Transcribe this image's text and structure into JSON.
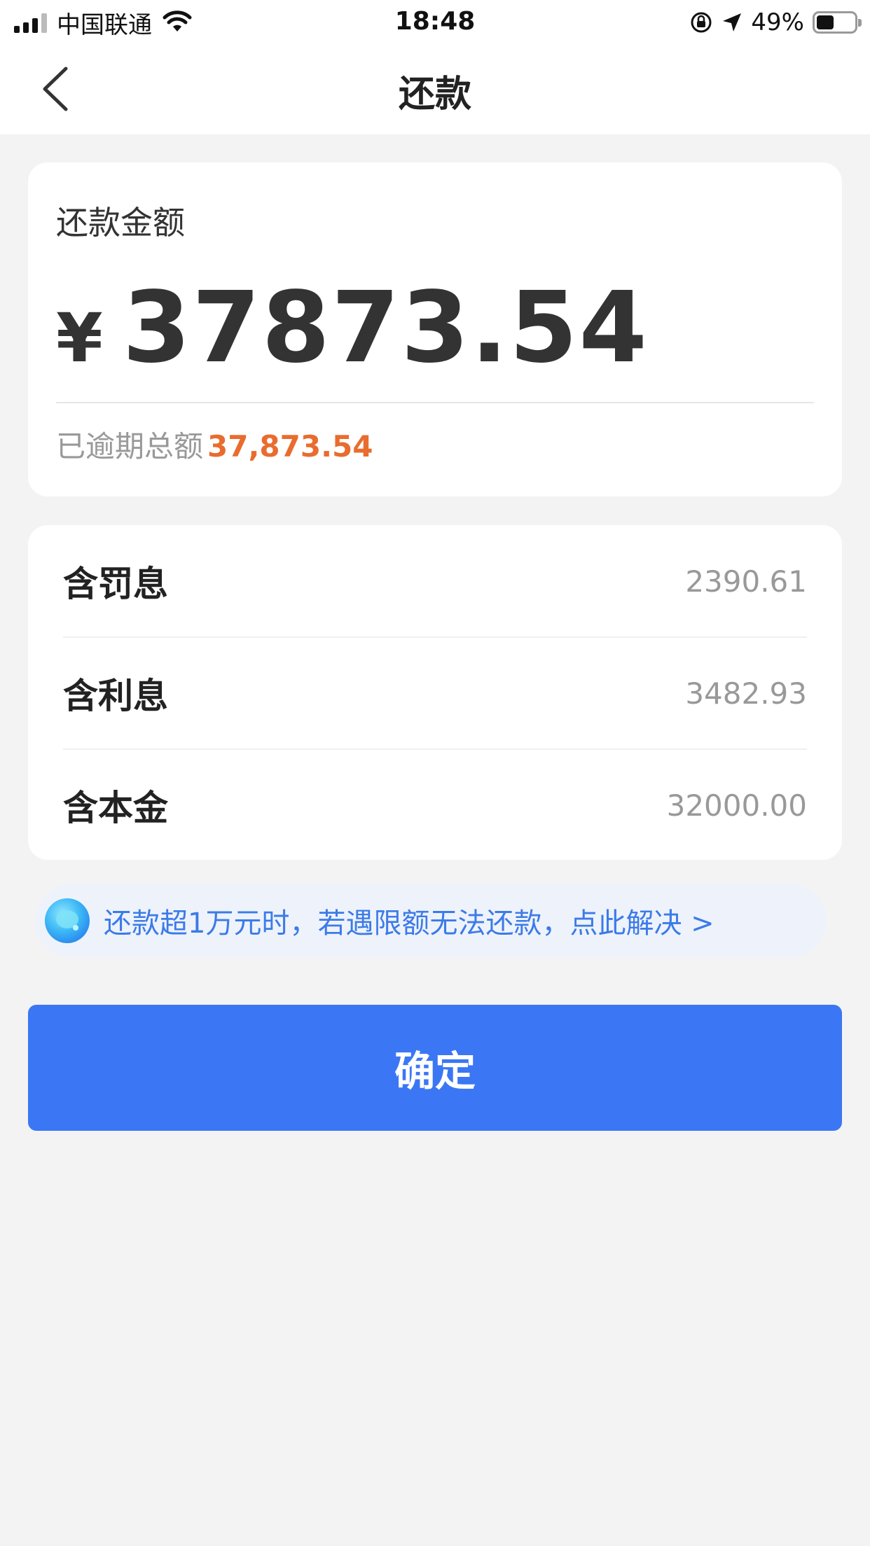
{
  "status_bar": {
    "carrier": "中国联通",
    "time": "18:48",
    "battery": "49%",
    "battery_level": 0.49
  },
  "nav": {
    "title": "还款"
  },
  "amount_card": {
    "label": "还款金额",
    "currency": "¥",
    "amount": "37873.54",
    "overdue_label": "已逾期总额",
    "overdue_value": "37,873.54"
  },
  "breakdown": {
    "rows": [
      {
        "label": "含罚息",
        "value": "2390.61"
      },
      {
        "label": "含利息",
        "value": "3482.93"
      },
      {
        "label": "含本金",
        "value": "32000.00"
      }
    ]
  },
  "tip": {
    "text": "还款超1万元时，若遇限额无法还款，点此解决 >"
  },
  "confirm_button": {
    "label": "确定"
  },
  "colors": {
    "primary": "#3b77f4",
    "overdue": "#e96c2f",
    "tip_text": "#3c7be8",
    "background": "#f3f3f4"
  }
}
